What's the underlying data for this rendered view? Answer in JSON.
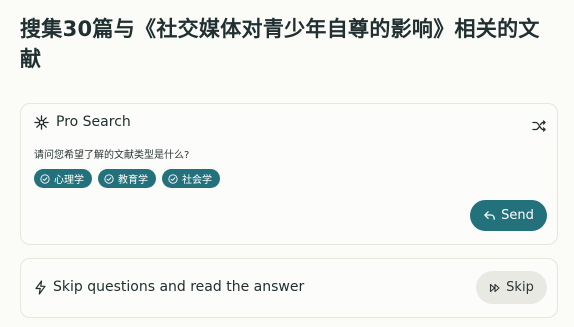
{
  "title": "搜集30篇与《社交媒体对青少年自尊的影响》相关的文献",
  "pro_search": {
    "label": "Pro Search",
    "icon": "sparkle-icon",
    "shuffle_icon": "shuffle-icon",
    "question": "请问您希望了解的文献类型是什么?",
    "options": [
      {
        "label": "心理学",
        "icon": "check-circle-icon"
      },
      {
        "label": "教育学",
        "icon": "check-circle-icon"
      },
      {
        "label": "社会学",
        "icon": "check-circle-icon"
      }
    ],
    "send_label": "Send",
    "send_icon": "reply-arrow-icon"
  },
  "skip": {
    "text": "Skip questions and read the answer",
    "icon": "lightning-icon",
    "button_label": "Skip",
    "button_icon": "fast-forward-icon"
  },
  "colors": {
    "accent": "#23717a",
    "background": "#fbfbf8",
    "skip_button_bg": "#e9e9e3"
  }
}
